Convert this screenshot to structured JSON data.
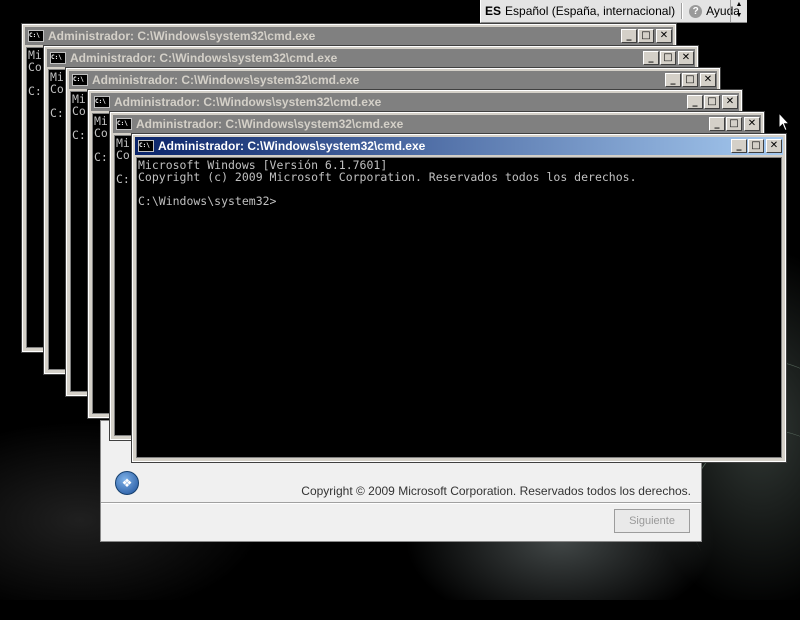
{
  "language_bar": {
    "code": "ES",
    "language": "Español (España, internacional)",
    "help_label": "Ayuda",
    "help_glyph": "?",
    "spin_up": "▲",
    "spin_down": "▼"
  },
  "setup_dialog": {
    "copyright": "Copyright © 2009 Microsoft Corporation. Reservados todos los derechos.",
    "next_button": "Siguiente"
  },
  "window_controls": {
    "minimize": "_",
    "maximize": "□",
    "close": "✕"
  },
  "cmd_windows": [
    {
      "title": "Administrador: C:\\Windows\\system32\\cmd.exe",
      "lines": [
        "Mi",
        "Co",
        "",
        "C:"
      ]
    },
    {
      "title": "Administrador: C:\\Windows\\system32\\cmd.exe",
      "lines": [
        "Mi",
        "Co",
        "",
        "C:"
      ]
    },
    {
      "title": "Administrador: C:\\Windows\\system32\\cmd.exe",
      "lines": [
        "Mi",
        "Co",
        "",
        "C:"
      ]
    },
    {
      "title": "Administrador: C:\\Windows\\system32\\cmd.exe",
      "lines": [
        "Mi",
        "Co",
        "",
        "C:"
      ]
    },
    {
      "title": "Administrador: C:\\Windows\\system32\\cmd.exe",
      "lines": [
        "Mi",
        "Co",
        "",
        "C:"
      ]
    },
    {
      "title": "Administrador: C:\\Windows\\system32\\cmd.exe",
      "lines": [
        "Microsoft Windows [Versión 6.1.7601]",
        "Copyright (c) 2009 Microsoft Corporation. Reservados todos los derechos.",
        "",
        "C:\\Windows\\system32>"
      ]
    }
  ],
  "colors": {
    "console_text": "#c0c0c0",
    "active_title_start": "#0a246a",
    "active_title_end": "#a6caf0",
    "inactive_title": "#808080"
  },
  "icons": {
    "cmd": "cmd-icon",
    "setup_logo": "windows-setup-icon",
    "help": "help-icon",
    "cursor": "mouse-cursor"
  }
}
